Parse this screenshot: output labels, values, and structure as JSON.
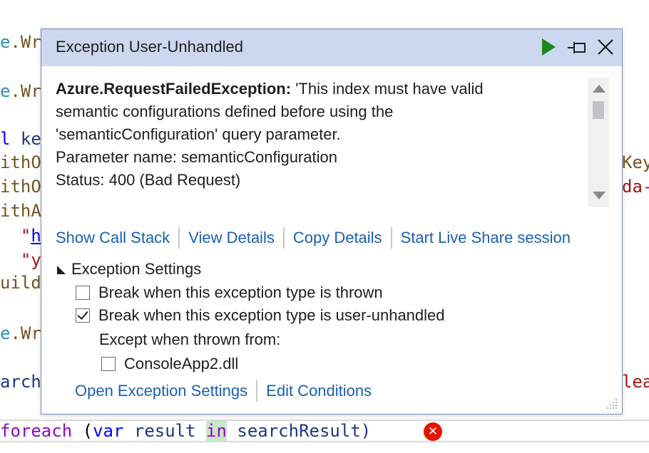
{
  "code": {
    "line1": {
      "type": "e",
      "rest": ".Wr"
    },
    "line2": {
      "type": "e",
      "rest": ".Wr"
    },
    "line3": {
      "kw": "l",
      "var": "ke"
    },
    "line4": {
      "fn": "ithO",
      "tail": "Key"
    },
    "line5": {
      "fn": "ithO",
      "tail": "da-"
    },
    "line6": {
      "fn": "ithA"
    },
    "line7": {
      "q": "\"",
      "link": "h"
    },
    "line8": {
      "q": "\"y"
    },
    "line9": {
      "fn": "uild"
    },
    "line10": {
      "type": "e",
      "rest": ".Wr"
    },
    "line11": {
      "var": "arch",
      "tail": "lea"
    },
    "foreach": {
      "kw": "foreach",
      "p1": " (",
      "var_kw": "var",
      "result": " result ",
      "in_kw": "in",
      "rest": " searchResult)"
    }
  },
  "error_icon": {
    "glyph": "✕",
    "color": "#e51400"
  },
  "popup": {
    "title": "Exception User-Unhandled",
    "buttons": {
      "continue": "play-icon",
      "pin": "pin-icon",
      "close": "close-icon"
    },
    "message": {
      "exception_type": "Azure.RequestFailedException:",
      "line1": " 'This index must have valid",
      "line2": "semantic configurations defined before using the",
      "line3": "'semanticConfiguration' query parameter.",
      "line4": "Parameter name: semanticConfiguration",
      "line5": "Status: 400 (Bad Request)"
    },
    "links": {
      "call_stack": "Show Call Stack",
      "view_details": "View Details",
      "copy_details": "Copy Details",
      "live_share": "Start Live Share session"
    },
    "settings": {
      "header": "Exception Settings",
      "thrown": {
        "label": "Break when this exception type is thrown",
        "checked": false
      },
      "unhandled": {
        "label": "Break when this exception type is user-unhandled",
        "checked": true
      },
      "except_label": "Except when thrown from:",
      "module": {
        "label": "ConsoleApp2.dll",
        "checked": false
      }
    },
    "bottom_links": {
      "open_settings": "Open Exception Settings",
      "edit_conditions": "Edit Conditions"
    }
  },
  "colors": {
    "accent": "#1a5fb4",
    "titlebar": "#cdd7ef",
    "play": "#1b8a1b"
  }
}
